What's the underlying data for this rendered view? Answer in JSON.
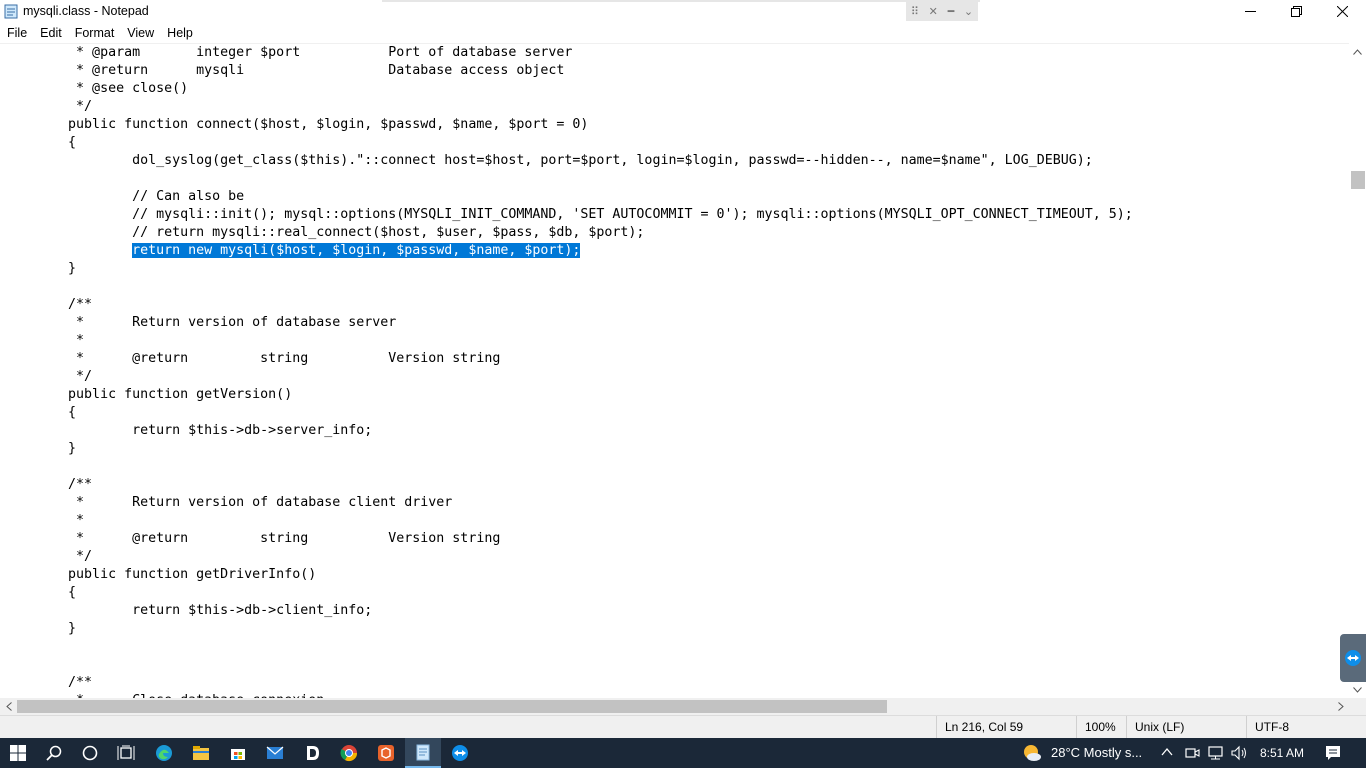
{
  "window": {
    "title": "mysqli.class - Notepad",
    "snap_icons": [
      "⠿",
      "✕",
      "━",
      "⌄"
    ]
  },
  "menu": [
    "File",
    "Edit",
    "Format",
    "View",
    "Help"
  ],
  "editor": {
    "lines": [
      "\t * @param\tinteger $port\t\tPort of database server",
      "\t * @return\tmysqli\t\t\tDatabase access object",
      "\t * @see close()",
      "\t */",
      "\tpublic function connect($host, $login, $passwd, $name, $port = 0)",
      "\t{",
      "\t\tdol_syslog(get_class($this).\"::connect host=$host, port=$port, login=$login, passwd=--hidden--, name=$name\", LOG_DEBUG);",
      "",
      "\t\t// Can also be",
      "\t\t// mysqli::init(); mysql::options(MYSQLI_INIT_COMMAND, 'SET AUTOCOMMIT = 0'); mysqli::options(MYSQLI_OPT_CONNECT_TIMEOUT, 5);",
      "\t\t// return mysqli::real_connect($host, $user, $pass, $db, $port);",
      "\t\treturn new mysqli($host, $login, $passwd, $name, $port);",
      "\t}",
      "",
      "\t/**",
      "\t *\tReturn version of database server",
      "\t *",
      "\t *\t@return\t\tstring\t\tVersion string",
      "\t */",
      "\tpublic function getVersion()",
      "\t{",
      "\t\treturn $this->db->server_info;",
      "\t}",
      "",
      "\t/**",
      "\t *\tReturn version of database client driver",
      "\t *",
      "\t *\t@return\t\tstring\t\tVersion string",
      "\t */",
      "\tpublic function getDriverInfo()",
      "\t{",
      "\t\treturn $this->db->client_info;",
      "\t}",
      "",
      "",
      "\t/**",
      "\t *\tClose database connexion"
    ],
    "selected_line_index": 11,
    "selected_prefix": "\t\t",
    "selected_text": "return new mysqli($host, $login, $passwd, $name, $port);"
  },
  "status": {
    "position": "Ln 216, Col 59",
    "zoom": "100%",
    "line_ending": "Unix (LF)",
    "encoding": "UTF-8"
  },
  "taskbar": {
    "icons": [
      "windows-start-icon",
      "search-icon",
      "cortana-icon",
      "task-view-icon",
      "edge-icon",
      "file-explorer-icon",
      "store-icon",
      "mail-icon",
      "dolibarr-icon",
      "chrome-icon",
      "app-orange-icon",
      "notepad-icon",
      "teamviewer-icon"
    ],
    "weather": "28°C  Mostly s...",
    "time": "8:51 AM"
  },
  "colors": {
    "selection": "#0078d7",
    "taskbar": "#1b2838",
    "statusbar": "#f0f0f0"
  }
}
